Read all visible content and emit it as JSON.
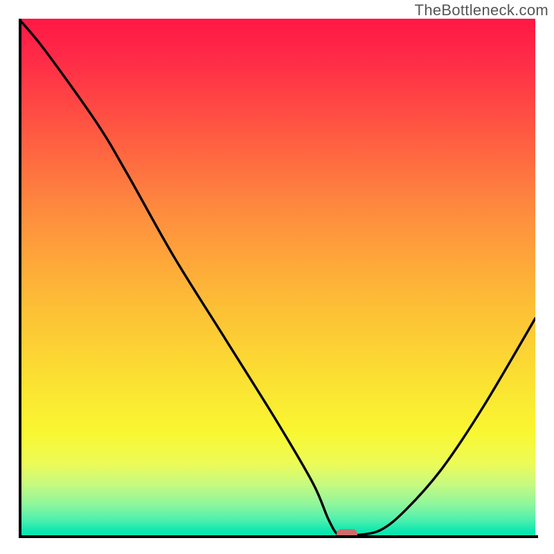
{
  "watermark": "TheBottleneck.com",
  "colors": {
    "gradient_top": "#ff1846",
    "gradient_mid": "#fdbd36",
    "gradient_bottom": "#07e5b0",
    "curve": "#000000",
    "axis": "#000000",
    "marker": "#cd6d6a"
  },
  "chart_data": {
    "type": "line",
    "title": "",
    "xlabel": "",
    "ylabel": "",
    "xlim": [
      0,
      100
    ],
    "ylim": [
      0,
      100
    ],
    "grid": false,
    "legend": false,
    "series": [
      {
        "name": "bottleneck-curve",
        "x": [
          0,
          5,
          15,
          21,
          30,
          40,
          50,
          57,
          60,
          62,
          65,
          70,
          75,
          82,
          90,
          100
        ],
        "values": [
          100,
          94,
          80,
          70,
          54,
          38,
          22,
          10,
          3,
          0,
          0,
          1,
          5,
          13,
          25,
          42
        ]
      }
    ],
    "marker": {
      "x": 63.5,
      "y": 0.3
    },
    "background": "vertical-gradient (red → orange → yellow → green)"
  }
}
